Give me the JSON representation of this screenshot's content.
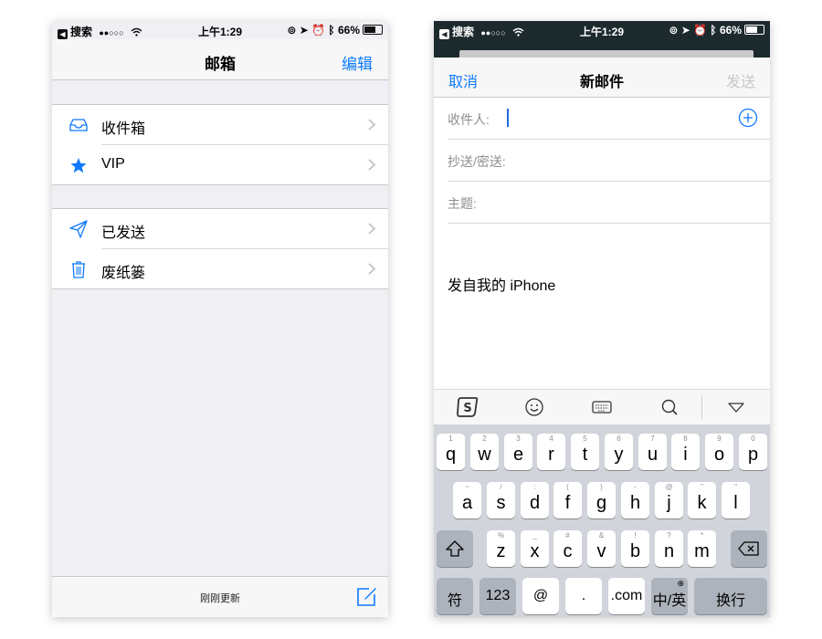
{
  "left_screen": {
    "status_bar": {
      "back_app": "搜索",
      "signal": "●●○○○",
      "time": "上午1:29",
      "battery": "66%",
      "battery_level": 0.66
    },
    "nav": {
      "title": "邮箱",
      "edit_label": "编辑"
    },
    "group1": [
      {
        "label": "收件箱",
        "icon": "inbox-icon"
      },
      {
        "label": "VIP",
        "icon": "star-icon"
      }
    ],
    "group2": [
      {
        "label": "已发送",
        "icon": "sent-icon"
      },
      {
        "label": "废纸篓",
        "icon": "trash-icon"
      }
    ],
    "toolbar": {
      "status": "刚刚更新",
      "compose_icon": "compose-icon"
    },
    "colors": {
      "accent": "#0e7afe",
      "background": "#efeff4"
    }
  },
  "right_screen": {
    "status_bar": {
      "back_app": "搜索",
      "signal": "●●○○○",
      "time": "上午1:29",
      "battery": "66%",
      "battery_level": 0.66
    },
    "compose": {
      "cancel_label": "取消",
      "title": "新邮件",
      "send_label": "发送",
      "to_label": "收件人:",
      "cc_label": "抄送/密送:",
      "subject_label": "主题:",
      "body": "发自我的 iPhone"
    },
    "suggestion_bar": [
      "sogou-logo-icon",
      "emoji-icon",
      "keyboard-icon",
      "search-icon",
      "hide-keyboard-icon"
    ],
    "keyboard": {
      "row1": [
        {
          "ch": "q",
          "hint": "1"
        },
        {
          "ch": "w",
          "hint": "2"
        },
        {
          "ch": "e",
          "hint": "3"
        },
        {
          "ch": "r",
          "hint": "4"
        },
        {
          "ch": "t",
          "hint": "5"
        },
        {
          "ch": "y",
          "hint": "6"
        },
        {
          "ch": "u",
          "hint": "7"
        },
        {
          "ch": "i",
          "hint": "8"
        },
        {
          "ch": "o",
          "hint": "9"
        },
        {
          "ch": "p",
          "hint": "0"
        }
      ],
      "row2": [
        {
          "ch": "a",
          "hint": "~"
        },
        {
          "ch": "s",
          "hint": "/"
        },
        {
          "ch": "d",
          "hint": ":"
        },
        {
          "ch": "f",
          "hint": "("
        },
        {
          "ch": "g",
          "hint": ")"
        },
        {
          "ch": "h",
          "hint": "-"
        },
        {
          "ch": "j",
          "hint": "@"
        },
        {
          "ch": "k",
          "hint": "\""
        },
        {
          "ch": "l",
          "hint": "\""
        }
      ],
      "row3": [
        {
          "ch": "z",
          "hint": "%"
        },
        {
          "ch": "x",
          "hint": "_"
        },
        {
          "ch": "c",
          "hint": "#"
        },
        {
          "ch": "v",
          "hint": "&"
        },
        {
          "ch": "b",
          "hint": "!"
        },
        {
          "ch": "n",
          "hint": "?"
        },
        {
          "ch": "m",
          "hint": "*"
        }
      ],
      "row4": {
        "symbols": "符",
        "numbers": "123",
        "at": "@",
        "dot": ".",
        "dotcom": ".com",
        "lang": "中/英",
        "return": "换行"
      }
    }
  }
}
